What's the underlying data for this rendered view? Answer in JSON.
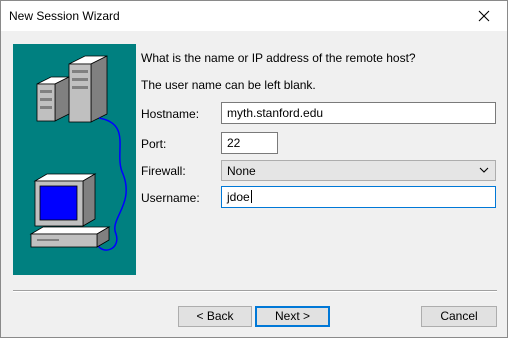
{
  "window": {
    "title": "New Session Wizard"
  },
  "prompt": {
    "question": "What is the name or IP address of the remote host?",
    "note": "The user name can be left blank."
  },
  "form": {
    "hostname_label": "Hostname:",
    "hostname_value": "myth.stanford.edu",
    "port_label": "Port:",
    "port_value": "22",
    "firewall_label": "Firewall:",
    "firewall_value": "None",
    "username_label": "Username:",
    "username_value": "jdoe"
  },
  "buttons": {
    "back": "< Back",
    "next": "Next >",
    "cancel": "Cancel"
  },
  "colors": {
    "art_background": "#008080",
    "focus_border": "#0078d7"
  },
  "icons": [
    "close-icon",
    "servers-icon",
    "computer-icon",
    "chevron-down-icon"
  ]
}
